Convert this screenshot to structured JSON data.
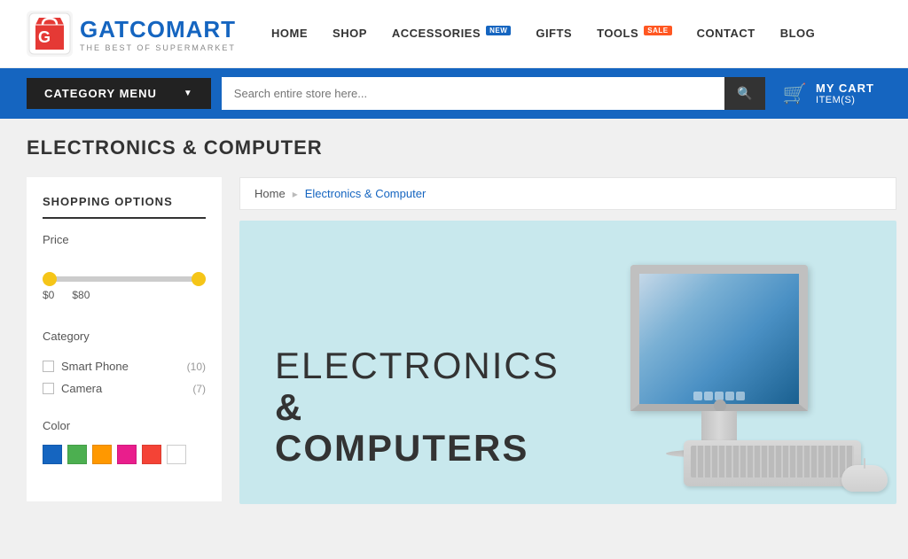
{
  "brand": {
    "name_part1": "GATCO",
    "name_part2": "MART",
    "tagline": "THE BEST OF SUPERMARKET"
  },
  "nav": {
    "items": [
      {
        "label": "HOME",
        "badge": null
      },
      {
        "label": "SHOP",
        "badge": null
      },
      {
        "label": "ACCESSORIES",
        "badge": "NEW",
        "badge_type": "new"
      },
      {
        "label": "GIFTS",
        "badge": null
      },
      {
        "label": "TOOLS",
        "badge": "SALE",
        "badge_type": "sale"
      },
      {
        "label": "CONTACT",
        "badge": null
      },
      {
        "label": "BLOG",
        "badge": null
      }
    ]
  },
  "search_bar": {
    "category_button": "CATEGORY MENU",
    "search_placeholder": "Search entire store here...",
    "cart_title": "MY CART",
    "cart_items": "ITEM(S)"
  },
  "page_title": "ELECTRONICS & COMPUTER",
  "sidebar": {
    "title": "SHOPPING OPTIONS",
    "price_section": {
      "label": "Price",
      "min": "$0",
      "max": "$80"
    },
    "category_section": {
      "label": "Category",
      "items": [
        {
          "name": "Smart Phone",
          "count": "(10)"
        },
        {
          "name": "Camera",
          "count": "(7)"
        }
      ]
    },
    "color_section": {
      "label": "Color",
      "swatches": [
        {
          "name": "blue",
          "hex": "#1565c0"
        },
        {
          "name": "green",
          "hex": "#4caf50"
        },
        {
          "name": "orange",
          "hex": "#ff9800"
        },
        {
          "name": "pink",
          "hex": "#e91e8c"
        },
        {
          "name": "red",
          "hex": "#f44336"
        },
        {
          "name": "white",
          "hex": "#ffffff"
        }
      ]
    }
  },
  "breadcrumb": {
    "home": "Home",
    "current": "Electronics & Computer"
  },
  "banner": {
    "line1": "ELECTRONICS",
    "line2": "& COMPUTERS"
  }
}
